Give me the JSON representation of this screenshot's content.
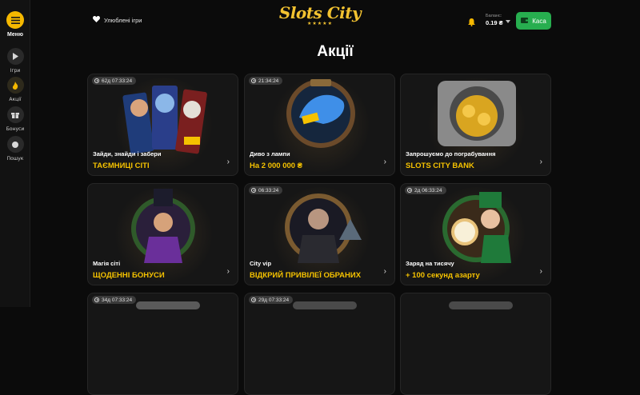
{
  "sidebar": {
    "items": [
      {
        "label": "Меню",
        "icon": "menu-icon"
      },
      {
        "label": "Ігри",
        "icon": "play-icon"
      },
      {
        "label": "Акції",
        "icon": "fire-icon"
      },
      {
        "label": "Бонуси",
        "icon": "gift-icon"
      },
      {
        "label": "Пошук",
        "icon": "search-icon"
      }
    ]
  },
  "header": {
    "favorites_label": "Улюблені ігри",
    "logo_text": "Slots City",
    "balance_label": "Баланс:",
    "balance_value": "0.19 ₴",
    "cash_label": "Каса"
  },
  "page": {
    "title": "Акції"
  },
  "cards": [
    {
      "timer": "62д 07:33:24",
      "subtitle": "Зайди, знайди і забери",
      "title": "ТАЄМНИЦІ СІТІ"
    },
    {
      "timer": "21:34:24",
      "subtitle": "Диво з лампи",
      "title": "На 2 000 000 ₴"
    },
    {
      "timer": "",
      "subtitle": "Запрошуємо до пограбування",
      "title": "SLOTS CITY BANK"
    },
    {
      "timer": "",
      "subtitle": "Магія сіті",
      "title": "ЩОДЕННІ БОНУСИ"
    },
    {
      "timer": "06:33:24",
      "subtitle": "City vip",
      "title": "ВІДКРИЙ ПРИВІЛЕЇ ОБРАНИХ"
    },
    {
      "timer": "2д 06:33:24",
      "subtitle": "Заряд на тисячу",
      "title": "+ 100 секунд азарту"
    },
    {
      "timer": "34д 07:33:24",
      "subtitle": "",
      "title": ""
    },
    {
      "timer": "29д 07:33:24",
      "subtitle": "",
      "title": ""
    },
    {
      "timer": "",
      "subtitle": "",
      "title": ""
    }
  ],
  "colors": {
    "accent": "#f5c200",
    "cash_button": "#27ae4f",
    "background": "#0b0b0b",
    "card": "#161616"
  }
}
